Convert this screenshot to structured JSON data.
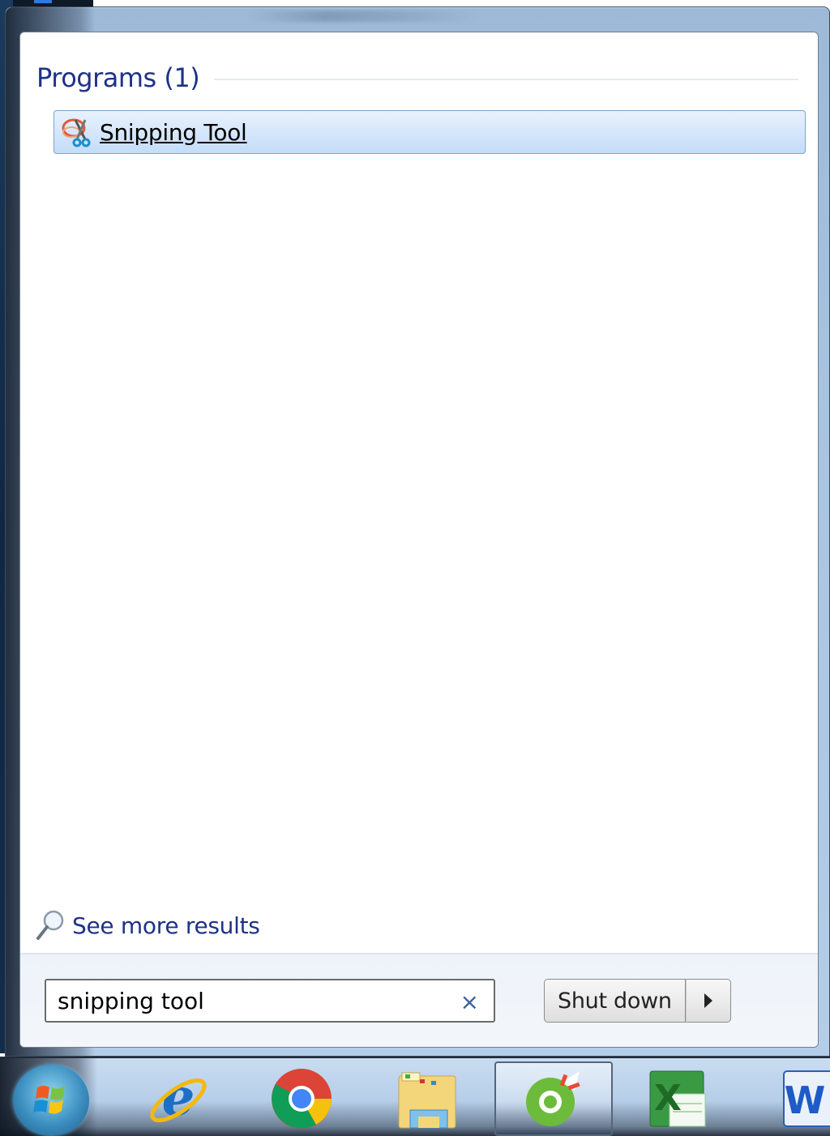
{
  "start_menu": {
    "section": {
      "title": "Programs (1)"
    },
    "results": [
      {
        "label": "Snipping Tool",
        "icon": "snipping-tool-icon"
      }
    ],
    "see_more": {
      "label": "See more results",
      "icon": "magnifier-icon"
    },
    "search": {
      "value": "snipping tool",
      "clear_glyph": "×"
    },
    "shutdown": {
      "label": "Shut down",
      "options_icon": "triangle-right-icon"
    }
  },
  "taskbar": {
    "start_button": "windows-orb-icon",
    "items": [
      {
        "name": "Internet Explorer",
        "icon": "internet-explorer-icon",
        "active": false
      },
      {
        "name": "Google Chrome",
        "icon": "chrome-icon",
        "active": false
      },
      {
        "name": "Windows Explorer",
        "icon": "folder-icon",
        "active": false
      },
      {
        "name": "Coc Coc",
        "icon": "coccoc-icon",
        "active": true
      },
      {
        "name": "Microsoft Excel",
        "icon": "excel-icon",
        "active": false
      },
      {
        "name": "Microsoft Word",
        "icon": "word-icon",
        "active": false
      }
    ]
  },
  "colors": {
    "header_text": "#1e3287",
    "selection_border": "#7da2ce",
    "selection_fill": "#d6e7fb",
    "clear_icon": "#3a5f9a"
  }
}
